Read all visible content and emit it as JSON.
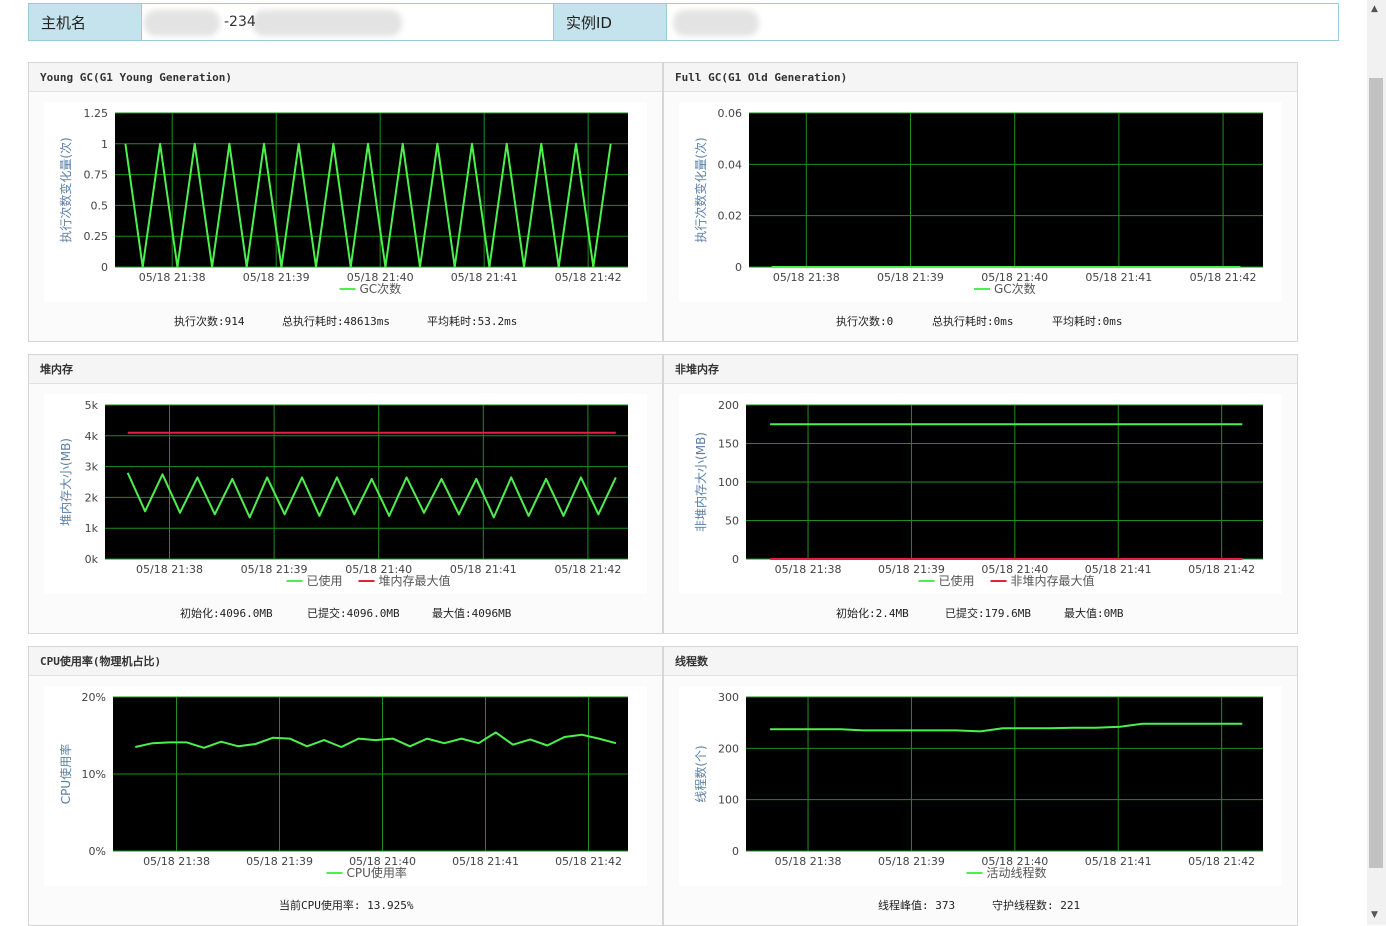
{
  "header": {
    "host_label": "主机名",
    "host_value": "-234",
    "instance_label": "实例ID",
    "instance_value": ""
  },
  "x_ticks": [
    "05/18 21:38",
    "05/18 21:39",
    "05/18 21:40",
    "05/18 21:41",
    "05/18 21:42"
  ],
  "panels": [
    {
      "title": "Young GC(G1 Young Generation)",
      "stats": [
        "执行次数:914",
        "总执行耗时:48613ms",
        "平均耗时:53.2ms"
      ]
    },
    {
      "title": "Full GC(G1 Old Generation)",
      "stats": [
        "执行次数:0",
        "总执行耗时:0ms",
        "平均耗时:0ms"
      ]
    },
    {
      "title": "堆内存",
      "stats": [
        "初始化:4096.0MB",
        "已提交:4096.0MB",
        "最大值:4096MB"
      ]
    },
    {
      "title": "非堆内存",
      "stats": [
        "初始化:2.4MB",
        "已提交:179.6MB",
        "最大值:0MB"
      ]
    },
    {
      "title": "CPU使用率(物理机占比)",
      "stats": [
        "当前CPU使用率: 13.925%"
      ]
    },
    {
      "title": "线程数",
      "stats": [
        "线程峰值: 373",
        "守护线程数: 221"
      ]
    }
  ],
  "colors": {
    "plot_bg": "#000000",
    "grid": "#1e8f1e",
    "series_green": "#4cf04c",
    "series_red": "#e3213a"
  },
  "chart_data": [
    {
      "type": "line",
      "ylabel": "执行次数变化量(次)",
      "yticks": [
        "0",
        "0.25",
        "0.5",
        "0.75",
        "1",
        "1.25"
      ],
      "ylim": [
        0,
        1.25
      ],
      "xlim": [
        "05/18 21:37:27",
        "05/18 21:42:23"
      ],
      "series": [
        {
          "name": "GC次数",
          "x": [
            "05/18 21:37:33",
            "05/18 21:37:43",
            "05/18 21:37:53",
            "05/18 21:38:03",
            "05/18 21:38:13",
            "05/18 21:38:23",
            "05/18 21:38:33",
            "05/18 21:38:43",
            "05/18 21:38:53",
            "05/18 21:39:03",
            "05/18 21:39:13",
            "05/18 21:39:23",
            "05/18 21:39:33",
            "05/18 21:39:43",
            "05/18 21:39:53",
            "05/18 21:40:03",
            "05/18 21:40:13",
            "05/18 21:40:23",
            "05/18 21:40:33",
            "05/18 21:40:43",
            "05/18 21:40:53",
            "05/18 21:41:03",
            "05/18 21:41:13",
            "05/18 21:41:23",
            "05/18 21:41:33",
            "05/18 21:41:43",
            "05/18 21:41:53",
            "05/18 21:42:03",
            "05/18 21:42:13"
          ],
          "values": [
            1,
            0,
            1,
            0,
            1,
            0,
            1,
            0,
            1,
            0,
            1,
            0,
            1,
            0,
            1,
            0,
            1,
            0,
            1,
            0,
            1,
            0,
            1,
            0,
            1,
            0,
            1,
            0,
            1
          ],
          "color": "#4cf04c"
        }
      ]
    },
    {
      "type": "line",
      "ylabel": "执行次数变化量(次)",
      "yticks": [
        "0",
        "0.02",
        "0.04",
        "0.06"
      ],
      "ylim": [
        0,
        0.06
      ],
      "xlim": [
        "05/18 21:37:27",
        "05/18 21:42:23"
      ],
      "series": [
        {
          "name": "GC次数",
          "x": [
            "05/18 21:37:40",
            "05/18 21:42:10"
          ],
          "values": [
            0,
            0
          ],
          "color": "#4cf04c"
        }
      ]
    },
    {
      "type": "line",
      "ylabel": "堆内存大小(MB)",
      "yticks": [
        "0k",
        "1k",
        "2k",
        "3k",
        "4k",
        "5k"
      ],
      "ylim": [
        0,
        5000
      ],
      "xlim": [
        "05/18 21:37:23",
        "05/18 21:42:23"
      ],
      "series": [
        {
          "name": "已使用",
          "x": [
            "05/18 21:37:36",
            "05/18 21:37:46",
            "05/18 21:37:56",
            "05/18 21:38:06",
            "05/18 21:38:16",
            "05/18 21:38:26",
            "05/18 21:38:36",
            "05/18 21:38:46",
            "05/18 21:38:56",
            "05/18 21:39:06",
            "05/18 21:39:16",
            "05/18 21:39:26",
            "05/18 21:39:36",
            "05/18 21:39:46",
            "05/18 21:39:56",
            "05/18 21:40:06",
            "05/18 21:40:16",
            "05/18 21:40:26",
            "05/18 21:40:36",
            "05/18 21:40:46",
            "05/18 21:40:56",
            "05/18 21:41:06",
            "05/18 21:41:16",
            "05/18 21:41:26",
            "05/18 21:41:36",
            "05/18 21:41:46",
            "05/18 21:41:56",
            "05/18 21:42:06",
            "05/18 21:42:16"
          ],
          "values": [
            2800,
            1550,
            2750,
            1500,
            2650,
            1450,
            2600,
            1350,
            2650,
            1450,
            2650,
            1400,
            2650,
            1450,
            2600,
            1400,
            2650,
            1500,
            2600,
            1450,
            2600,
            1350,
            2650,
            1400,
            2600,
            1400,
            2650,
            1450,
            2650
          ],
          "color": "#4cf04c"
        },
        {
          "name": "堆内存最大值",
          "x": [
            "05/18 21:37:36",
            "05/18 21:42:16"
          ],
          "values": [
            4096,
            4096
          ],
          "color": "#e3213a"
        }
      ]
    },
    {
      "type": "line",
      "ylabel": "非堆内存大小(MB)",
      "yticks": [
        "0",
        "50",
        "100",
        "150",
        "200"
      ],
      "ylim": [
        0,
        200
      ],
      "xlim": [
        "05/18 21:37:24",
        "05/18 21:42:24"
      ],
      "series": [
        {
          "name": "已使用",
          "x": [
            "05/18 21:37:38",
            "05/18 21:42:12"
          ],
          "values": [
            175,
            175
          ],
          "color": "#4cf04c"
        },
        {
          "name": "非堆内存最大值",
          "x": [
            "05/18 21:37:38",
            "05/18 21:42:12"
          ],
          "values": [
            0,
            0
          ],
          "color": "#e3213a"
        }
      ]
    },
    {
      "type": "line",
      "ylabel": "CPU使用率",
      "yticks": [
        "0%",
        "10%",
        "20%"
      ],
      "ylim": [
        0,
        20
      ],
      "xlim": [
        "05/18 21:37:23",
        "05/18 21:42:23"
      ],
      "series": [
        {
          "name": "CPU使用率",
          "x": [
            "05/18 21:37:36",
            "05/18 21:37:46",
            "05/18 21:37:56",
            "05/18 21:38:06",
            "05/18 21:38:16",
            "05/18 21:38:26",
            "05/18 21:38:36",
            "05/18 21:38:46",
            "05/18 21:38:56",
            "05/18 21:39:06",
            "05/18 21:39:16",
            "05/18 21:39:26",
            "05/18 21:39:36",
            "05/18 21:39:46",
            "05/18 21:39:56",
            "05/18 21:40:06",
            "05/18 21:40:16",
            "05/18 21:40:26",
            "05/18 21:40:36",
            "05/18 21:40:46",
            "05/18 21:40:56",
            "05/18 21:41:06",
            "05/18 21:41:16",
            "05/18 21:41:26",
            "05/18 21:41:36",
            "05/18 21:41:46",
            "05/18 21:41:56",
            "05/18 21:42:06",
            "05/18 21:42:16"
          ],
          "values": [
            13.5,
            14.0,
            14.1,
            14.1,
            13.4,
            14.2,
            13.6,
            13.9,
            14.7,
            14.6,
            13.6,
            14.4,
            13.5,
            14.6,
            14.4,
            14.6,
            13.6,
            14.6,
            14.0,
            14.6,
            14.0,
            15.4,
            13.8,
            14.5,
            13.7,
            14.8,
            15.1,
            14.6,
            14.0
          ],
          "color": "#4cf04c"
        }
      ]
    },
    {
      "type": "line",
      "ylabel": "线程数(个)",
      "yticks": [
        "0",
        "100",
        "200",
        "300"
      ],
      "ylim": [
        0,
        300
      ],
      "xlim": [
        "05/18 21:37:24",
        "05/18 21:42:24"
      ],
      "series": [
        {
          "name": "活动线程数",
          "x": [
            "05/18 21:37:38",
            "05/18 21:37:52",
            "05/18 21:38:05",
            "05/18 21:38:19",
            "05/18 21:38:32",
            "05/18 21:38:46",
            "05/18 21:38:59",
            "05/18 21:39:13",
            "05/18 21:39:26",
            "05/18 21:39:40",
            "05/18 21:39:53",
            "05/18 21:40:07",
            "05/18 21:40:20",
            "05/18 21:40:34",
            "05/18 21:40:47",
            "05/18 21:41:01",
            "05/18 21:41:14",
            "05/18 21:41:28",
            "05/18 21:41:41",
            "05/18 21:41:55",
            "05/18 21:42:12"
          ],
          "values": [
            237,
            237,
            237,
            237,
            235,
            235,
            235,
            235,
            235,
            233,
            239,
            239,
            239,
            240,
            240,
            242,
            248,
            248,
            248,
            248,
            248
          ],
          "color": "#4cf04c"
        }
      ]
    }
  ]
}
